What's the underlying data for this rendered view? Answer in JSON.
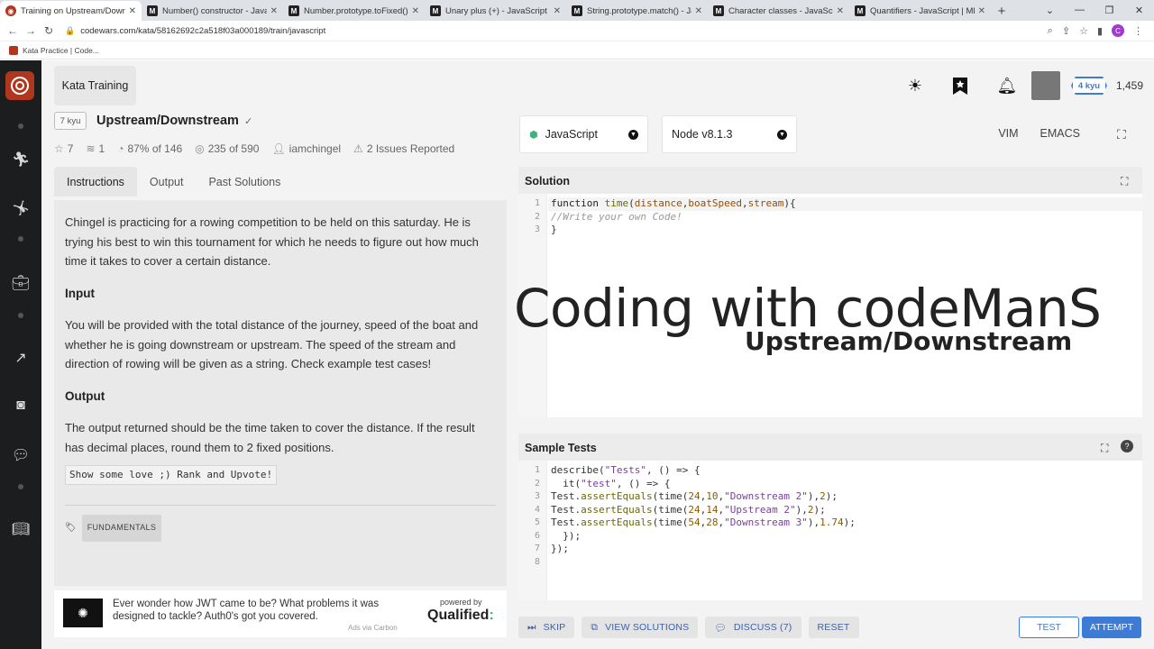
{
  "browser": {
    "tabs": [
      {
        "title": "Training on Upstream/Downstre",
        "fav": "",
        "active": true
      },
      {
        "title": "Number() constructor - JavaScr",
        "fav": "M"
      },
      {
        "title": "Number.prototype.toFixed() - Ja",
        "fav": "M"
      },
      {
        "title": "Unary plus (+) - JavaScript | MD",
        "fav": "M"
      },
      {
        "title": "String.prototype.match() - JavaS",
        "fav": "M"
      },
      {
        "title": "Character classes - JavaScript |",
        "fav": "M"
      },
      {
        "title": "Quantifiers - JavaScript | MDN",
        "fav": "M"
      }
    ],
    "url": "codewars.com/kata/58162692c2a518f03a000189/train/javascript",
    "profile_initial": "C",
    "bookmark": "Kata Practice | Code..."
  },
  "header": {
    "crumb": "Kata Training",
    "rank": "4 kyu",
    "honor": "1,459"
  },
  "kata": {
    "kyu": "7 kyu",
    "title": "Upstream/Downstream",
    "stats": {
      "stars": "7",
      "collections": "1",
      "satisfaction": "87%",
      "satisfaction_of": "of 146",
      "completed": "235",
      "completed_of": "of 590",
      "author": "iamchingel",
      "issues": "2 Issues Reported"
    }
  },
  "desc_tabs": [
    "Instructions",
    "Output",
    "Past Solutions"
  ],
  "description": {
    "p1": "Chingel is practicing for a rowing competition to be held on this saturday. He is trying his best to win this tournament for which he needs to figure out how much time it takes to cover a certain distance.",
    "h_input": "Input",
    "p2": "You will be provided with the total distance of the journey, speed of the boat and whether he is going downstream or upstream. The speed of the stream and direction of rowing will be given as a string. Check example test cases!",
    "h_output": "Output",
    "p3": "The output returned should be the time taken to cover the distance. If the result has decimal places, round them to 2 fixed positions.",
    "code": "Show some love ;) Rank and Upvote!",
    "tag": "FUNDAMENTALS"
  },
  "ad": {
    "text": "Ever wonder how JWT came to be? What problems it was designed to tackle? Auth0's got you covered.",
    "via": "Ads via Carbon",
    "powered": "powered by",
    "brand": "Qualified"
  },
  "editor": {
    "language": "JavaScript",
    "version": "Node v8.1.3",
    "modes": [
      "VIM",
      "EMACS"
    ],
    "solution_label": "Solution",
    "tests_label": "Sample Tests"
  },
  "watermark": {
    "line1": "Coding with codeManS",
    "line2": "Upstream/Downstream"
  },
  "actions": {
    "skip": "SKIP",
    "view": "VIEW SOLUTIONS",
    "discuss": "DISCUSS (7)",
    "reset": "RESET",
    "test": "TEST",
    "attempt": "ATTEMPT"
  }
}
